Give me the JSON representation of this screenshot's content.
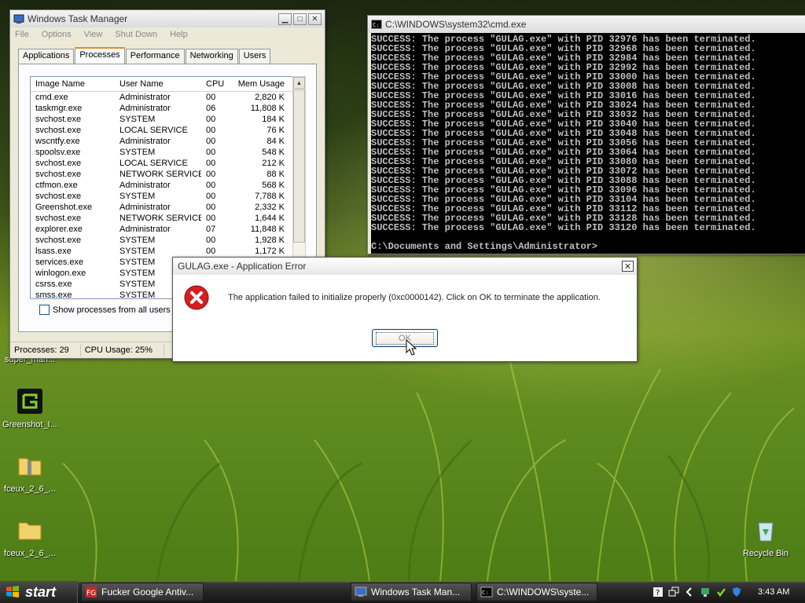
{
  "desktop": {
    "icons": [
      {
        "label": "Greenshot_I..."
      },
      {
        "label": "fceux_2_6_..."
      },
      {
        "label": "fceux_2_6_..."
      },
      {
        "label": "Recycle Bin"
      }
    ],
    "partial_label": "super_mari..."
  },
  "task_manager": {
    "title": "Windows Task Manager",
    "menu": [
      "File",
      "Options",
      "View",
      "Shut Down",
      "Help"
    ],
    "tabs": [
      "Applications",
      "Processes",
      "Performance",
      "Networking",
      "Users"
    ],
    "active_tab": "Processes",
    "columns": [
      "Image Name",
      "User Name",
      "CPU",
      "Mem Usage"
    ],
    "rows": [
      [
        "cmd.exe",
        "Administrator",
        "00",
        "2,820 K"
      ],
      [
        "taskmgr.exe",
        "Administrator",
        "06",
        "11,808 K"
      ],
      [
        "svchost.exe",
        "SYSTEM",
        "00",
        "184 K"
      ],
      [
        "svchost.exe",
        "LOCAL SERVICE",
        "00",
        "76 K"
      ],
      [
        "wscntfy.exe",
        "Administrator",
        "00",
        "84 K"
      ],
      [
        "spoolsv.exe",
        "SYSTEM",
        "00",
        "548 K"
      ],
      [
        "svchost.exe",
        "LOCAL SERVICE",
        "00",
        "212 K"
      ],
      [
        "svchost.exe",
        "NETWORK SERVICE",
        "00",
        "88 K"
      ],
      [
        "ctfmon.exe",
        "Administrator",
        "00",
        "568 K"
      ],
      [
        "svchost.exe",
        "SYSTEM",
        "00",
        "7,788 K"
      ],
      [
        "Greenshot.exe",
        "Administrator",
        "00",
        "2,332 K"
      ],
      [
        "svchost.exe",
        "NETWORK SERVICE",
        "00",
        "1,644 K"
      ],
      [
        "explorer.exe",
        "Administrator",
        "07",
        "11,848 K"
      ],
      [
        "svchost.exe",
        "SYSTEM",
        "00",
        "1,928 K"
      ],
      [
        "lsass.exe",
        "SYSTEM",
        "00",
        "1,172 K"
      ],
      [
        "services.exe",
        "SYSTEM",
        "",
        ""
      ],
      [
        "winlogon.exe",
        "SYSTEM",
        "",
        ""
      ],
      [
        "csrss.exe",
        "SYSTEM",
        "",
        ""
      ],
      [
        "smss.exe",
        "SYSTEM",
        "",
        ""
      ]
    ],
    "show_all_label": "Show processes from all users",
    "status_processes": "Processes: 29",
    "status_cpu": "CPU Usage: 25%"
  },
  "cmd": {
    "title": "C:\\WINDOWS\\system32\\cmd.exe",
    "lines": [
      "SUCCESS: The process \"GULAG.exe\" with PID 32976 has been terminated.",
      "SUCCESS: The process \"GULAG.exe\" with PID 32968 has been terminated.",
      "SUCCESS: The process \"GULAG.exe\" with PID 32984 has been terminated.",
      "SUCCESS: The process \"GULAG.exe\" with PID 32992 has been terminated.",
      "SUCCESS: The process \"GULAG.exe\" with PID 33000 has been terminated.",
      "SUCCESS: The process \"GULAG.exe\" with PID 33008 has been terminated.",
      "SUCCESS: The process \"GULAG.exe\" with PID 33016 has been terminated.",
      "SUCCESS: The process \"GULAG.exe\" with PID 33024 has been terminated.",
      "SUCCESS: The process \"GULAG.exe\" with PID 33032 has been terminated.",
      "SUCCESS: The process \"GULAG.exe\" with PID 33040 has been terminated.",
      "SUCCESS: The process \"GULAG.exe\" with PID 33048 has been terminated.",
      "SUCCESS: The process \"GULAG.exe\" with PID 33056 has been terminated.",
      "SUCCESS: The process \"GULAG.exe\" with PID 33064 has been terminated.",
      "SUCCESS: The process \"GULAG.exe\" with PID 33080 has been terminated.",
      "SUCCESS: The process \"GULAG.exe\" with PID 33072 has been terminated.",
      "SUCCESS: The process \"GULAG.exe\" with PID 33088 has been terminated.",
      "SUCCESS: The process \"GULAG.exe\" with PID 33096 has been terminated.",
      "SUCCESS: The process \"GULAG.exe\" with PID 33104 has been terminated.",
      "SUCCESS: The process \"GULAG.exe\" with PID 33112 has been terminated.",
      "SUCCESS: The process \"GULAG.exe\" with PID 33128 has been terminated.",
      "SUCCESS: The process \"GULAG.exe\" with PID 33120 has been terminated."
    ],
    "prompt": "C:\\Documents and Settings\\Administrator>"
  },
  "error_dialog": {
    "title": "GULAG.exe - Application Error",
    "message": "The application failed to initialize properly (0xc0000142). Click on OK to terminate the application.",
    "ok_label": "OK",
    "icon": "error-icon"
  },
  "taskbar": {
    "start_label": "start",
    "buttons": [
      {
        "label": "Fucker Google Antiv..."
      },
      {
        "label": "Windows Task Man..."
      },
      {
        "label": "C:\\WINDOWS\\syste..."
      }
    ],
    "clock": "3:43 AM"
  },
  "colors": {
    "error_red": "#d42020",
    "cmd_text": "#c0c0c0",
    "active_tab_accent": "#e68b2c"
  }
}
